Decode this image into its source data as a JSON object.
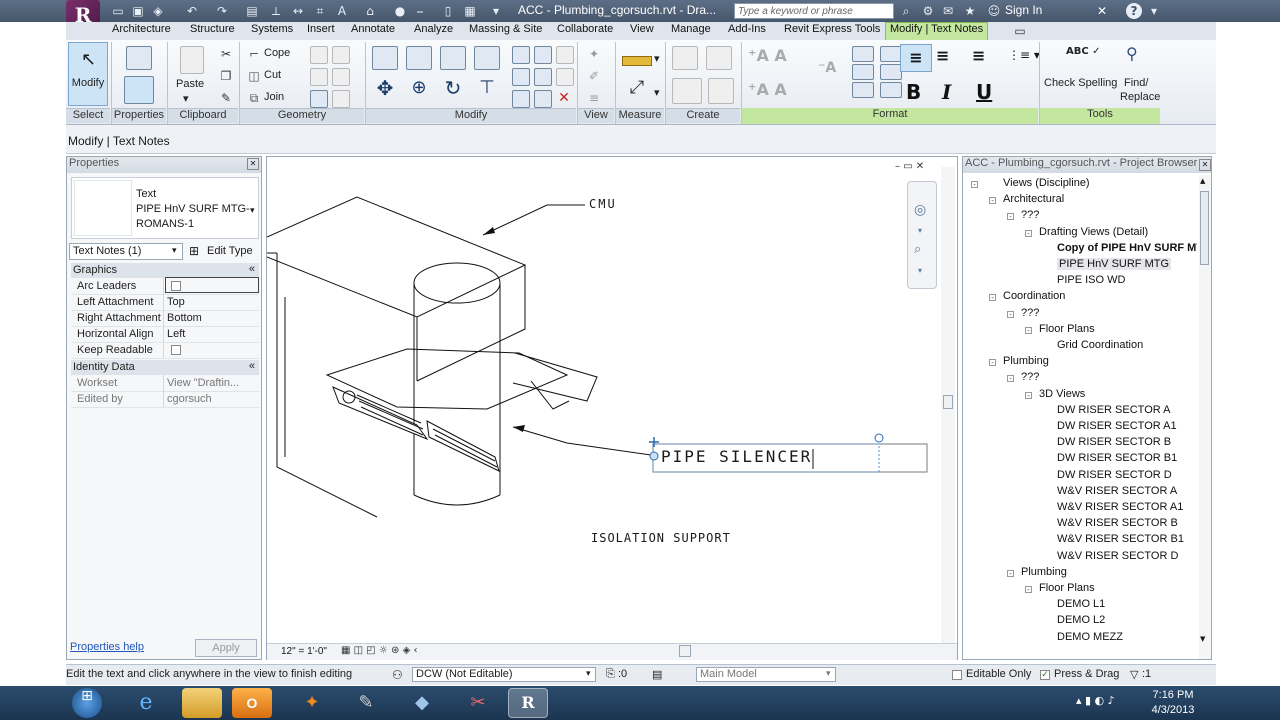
{
  "window": {
    "title": "ACC - Plumbing_cgorsuch.rvt - Dra...",
    "search_placeholder": "Type a keyword or phrase",
    "sign_in": "Sign In"
  },
  "tabs": [
    "Architecture",
    "Structure",
    "Systems",
    "Insert",
    "Annotate",
    "Analyze",
    "Massing & Site",
    "Collaborate",
    "View",
    "Manage",
    "Add-Ins",
    "Revit Express Tools",
    "Modify | Text Notes"
  ],
  "ribbon": {
    "modify": "Modify",
    "properties": "Properties",
    "paste": "Paste",
    "cope": "Cope",
    "cut": "Cut",
    "join": "Join",
    "check_spelling": "Check Spelling",
    "find_replace_1": "Find/",
    "find_replace_2": "Replace",
    "bold": "B",
    "italic": "I",
    "underline": "U",
    "panels": {
      "select": "Select",
      "properties": "Properties",
      "clipboard": "Clipboard",
      "geometry": "Geometry",
      "modify": "Modify",
      "view": "View",
      "measure": "Measure",
      "create": "Create",
      "format": "Format",
      "tools": "Tools"
    }
  },
  "context_label": "Modify | Text Notes",
  "properties": {
    "title": "Properties",
    "type_family": "Text",
    "type_name_1": "PIPE HnV SURF MTG-",
    "type_name_2": "ROMANS-1",
    "instance_selector": "Text Notes (1)",
    "edit_type": "Edit Type",
    "group_graphics": "Graphics",
    "rows": [
      {
        "key": "Arc Leaders",
        "value": ""
      },
      {
        "key": "Left Attachment",
        "value": "Top"
      },
      {
        "key": "Right Attachment",
        "value": "Bottom"
      },
      {
        "key": "Horizontal Align",
        "value": "Left"
      },
      {
        "key": "Keep Readable",
        "value": ""
      }
    ],
    "group_identity": "Identity Data",
    "identity_rows": [
      {
        "key": "Workset",
        "value": "View \"Draftin..."
      },
      {
        "key": "Edited by",
        "value": "cgorsuch"
      }
    ],
    "help": "Properties help",
    "apply": "Apply"
  },
  "drawing": {
    "label_cmu": "CMU",
    "label_pipe_silencer": "PIPE SILENCER",
    "label_isolation": "ISOLATION SUPPORT",
    "scale": "12\" = 1'-0\""
  },
  "browser": {
    "title": "ACC - Plumbing_cgorsuch.rvt - Project Browser",
    "items": [
      {
        "label": "Views (Discipline)",
        "level": 0,
        "toggle": "-"
      },
      {
        "label": "Architectural",
        "level": 1,
        "toggle": "-"
      },
      {
        "label": "???",
        "level": 2,
        "toggle": "-"
      },
      {
        "label": "Drafting Views (Detail)",
        "level": 3,
        "toggle": "-"
      },
      {
        "label": "Copy of PIPE HnV SURF MTG",
        "level": 4,
        "toggle": "",
        "bold": true
      },
      {
        "label": "PIPE HnV SURF MTG",
        "level": 4,
        "toggle": "",
        "selected": true
      },
      {
        "label": "PIPE ISO WD",
        "level": 4,
        "toggle": ""
      },
      {
        "label": "Coordination",
        "level": 1,
        "toggle": "-"
      },
      {
        "label": "???",
        "level": 2,
        "toggle": "-"
      },
      {
        "label": "Floor Plans",
        "level": 3,
        "toggle": "-"
      },
      {
        "label": "Grid Coordination",
        "level": 4,
        "toggle": ""
      },
      {
        "label": "Plumbing",
        "level": 1,
        "toggle": "-"
      },
      {
        "label": "???",
        "level": 2,
        "toggle": "-"
      },
      {
        "label": "3D Views",
        "level": 3,
        "toggle": "-"
      },
      {
        "label": "DW RISER SECTOR A",
        "level": 4,
        "toggle": ""
      },
      {
        "label": "DW RISER SECTOR A1",
        "level": 4,
        "toggle": ""
      },
      {
        "label": "DW RISER SECTOR B",
        "level": 4,
        "toggle": ""
      },
      {
        "label": "DW RISER SECTOR B1",
        "level": 4,
        "toggle": ""
      },
      {
        "label": "DW RISER SECTOR D",
        "level": 4,
        "toggle": ""
      },
      {
        "label": "W&V RISER SECTOR A",
        "level": 4,
        "toggle": ""
      },
      {
        "label": "W&V RISER SECTOR A1",
        "level": 4,
        "toggle": ""
      },
      {
        "label": "W&V RISER SECTOR B",
        "level": 4,
        "toggle": ""
      },
      {
        "label": "W&V RISER SECTOR B1",
        "level": 4,
        "toggle": ""
      },
      {
        "label": "W&V RISER SECTOR D",
        "level": 4,
        "toggle": ""
      },
      {
        "label": "Plumbing",
        "level": 2,
        "toggle": "-"
      },
      {
        "label": "Floor Plans",
        "level": 3,
        "toggle": "-"
      },
      {
        "label": "DEMO L1",
        "level": 4,
        "toggle": ""
      },
      {
        "label": "DEMO L2",
        "level": 4,
        "toggle": ""
      },
      {
        "label": "DEMO MEZZ",
        "level": 4,
        "toggle": ""
      }
    ]
  },
  "status": {
    "hint": "Edit the text and click anywhere in the view to finish editing",
    "workset": "DCW (Not Editable)",
    "zero": ":0",
    "model": "Main Model",
    "editable_only": "Editable Only",
    "press_drag": "Press & Drag",
    "filter": ":1"
  },
  "clock": {
    "time": "7:16 PM",
    "date": "4/3/2013"
  },
  "colors": {
    "accent_green": "#c4e7a0",
    "titlebar": "#4f6076",
    "taskbar": "#234262"
  }
}
